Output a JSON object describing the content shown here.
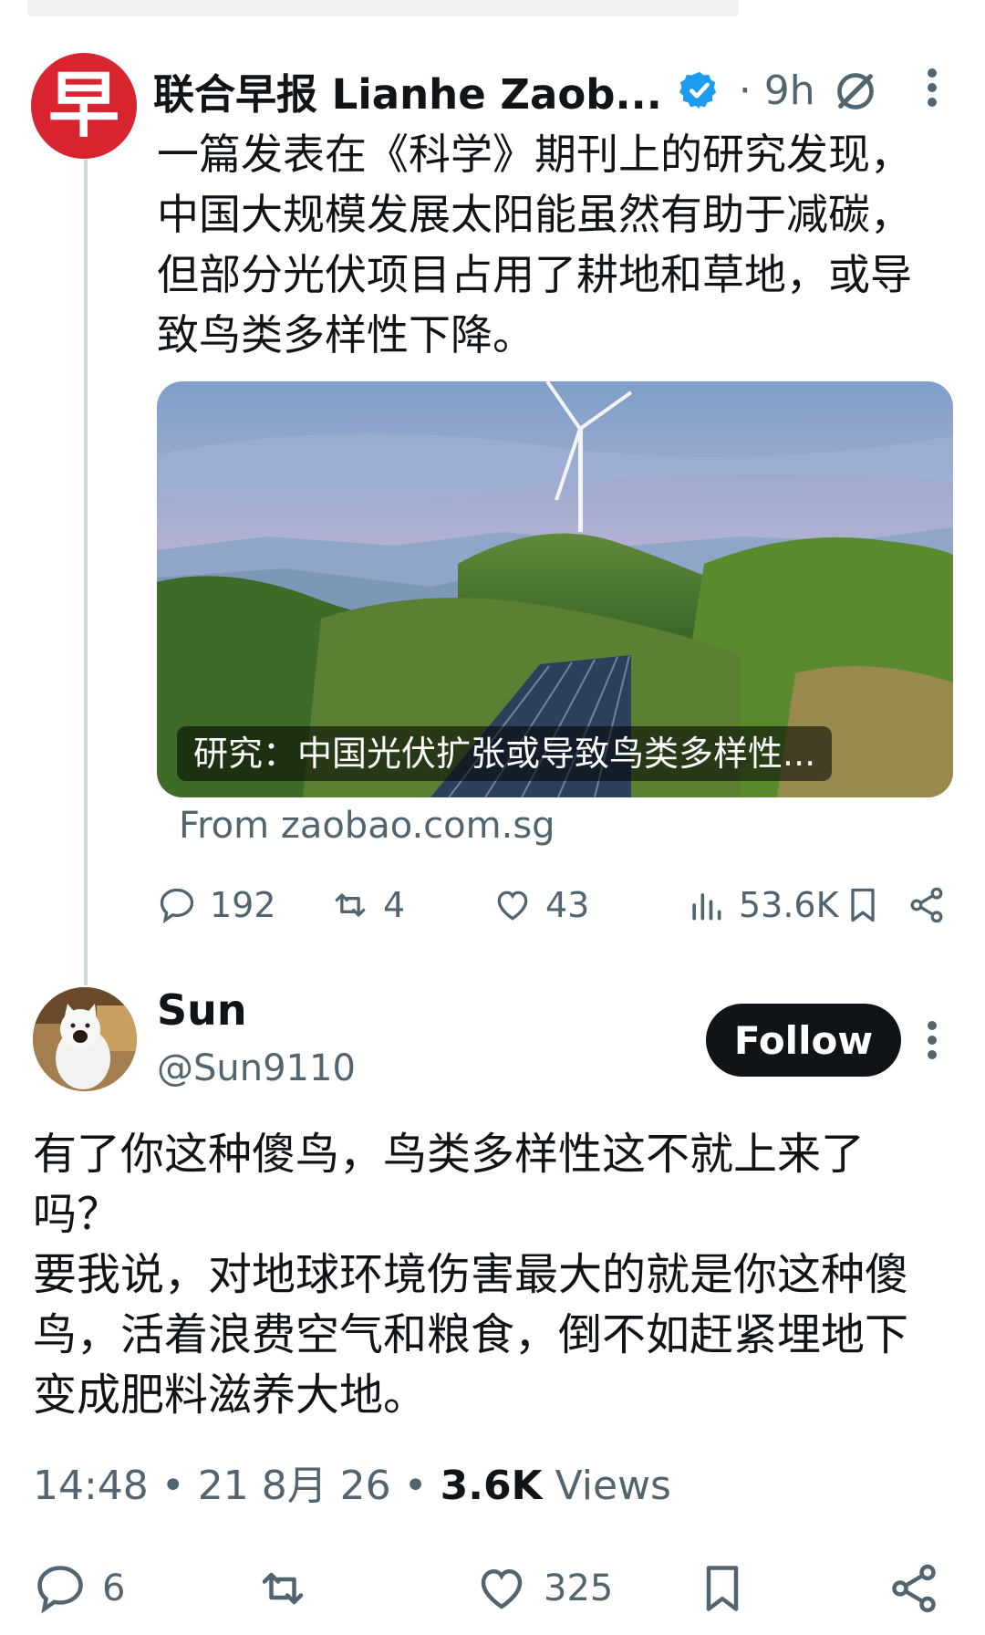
{
  "tweet": {
    "author": "联合早报 Lianhe Zaob...",
    "avatar_char": "早",
    "time": "· 9h",
    "text": "一篇发表在《科学》期刊上的研究发现，中国大规模发展太阳能虽然有助于减碳，但部分光伏项目占用了耕地和草地，或导致鸟类多样性下降。",
    "card_caption": "研究：中国光伏扩张或导致鸟类多样性...",
    "card_source": "From zaobao.com.sg",
    "replies": "192",
    "reposts": "4",
    "likes": "43",
    "views": "53.6K"
  },
  "reply": {
    "name": "Sun",
    "handle": "@Sun9110",
    "follow_label": "Follow",
    "text": "有了你这种傻鸟，鸟类多样性这不就上来了吗？\n要我说，对地球环境伤害最大的就是你这种傻鸟，活着浪费空气和粮食，倒不如赶紧埋地下变成肥料滋养大地。",
    "meta_time": "14:48 • 21 8月 26 • ",
    "meta_views_count": "3.6K",
    "meta_views_label": " Views",
    "replies": "6",
    "likes": "325"
  },
  "colors": {
    "accent": "#1d9bf0",
    "muted": "#536471",
    "brand": "#d8252f"
  }
}
